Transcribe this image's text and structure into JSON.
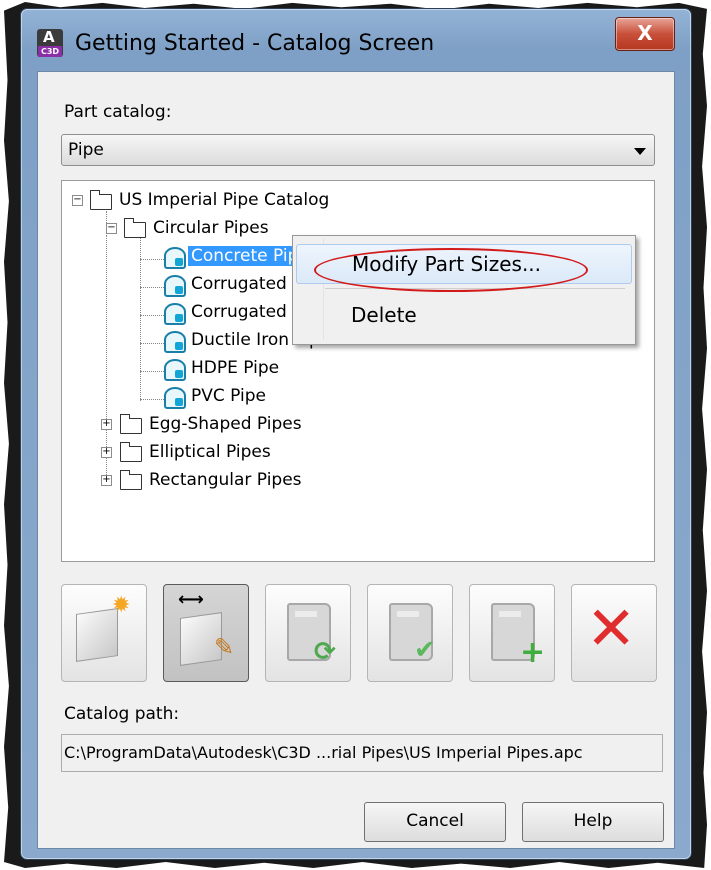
{
  "window": {
    "title": "Getting Started - Catalog Screen",
    "close_glyph": "X"
  },
  "app_icon": {
    "name": "autocad-civil3d-icon",
    "letter": "A",
    "sub": "C3D"
  },
  "part_catalog": {
    "label": "Part catalog:",
    "selected": "Pipe"
  },
  "tree": {
    "root": "US Imperial Pipe Catalog",
    "circular": "Circular Pipes",
    "items": [
      "Concrete Pipe",
      "Corrugated HD",
      "Corrugated Me",
      "Ductile Iron Pip",
      "HDPE Pipe",
      "PVC Pipe"
    ],
    "egg": "Egg-Shaped Pipes",
    "elliptical": "Elliptical Pipes",
    "rectangular": "Rectangular Pipes"
  },
  "context_menu": {
    "modify": "Modify Part Sizes...",
    "delete": "Delete"
  },
  "toolbar": {
    "icons": [
      "new-catalog-icon",
      "edit-catalog-icon",
      "regenerate-catalog-icon",
      "check-catalog-icon",
      "add-catalog-icon",
      "delete-catalog-icon"
    ]
  },
  "catalog_path": {
    "label": "Catalog path:",
    "value": "C:\\ProgramData\\Autodesk\\C3D ...rial Pipes\\US Imperial Pipes.apc"
  },
  "buttons": {
    "cancel": "Cancel",
    "help": "Help"
  }
}
